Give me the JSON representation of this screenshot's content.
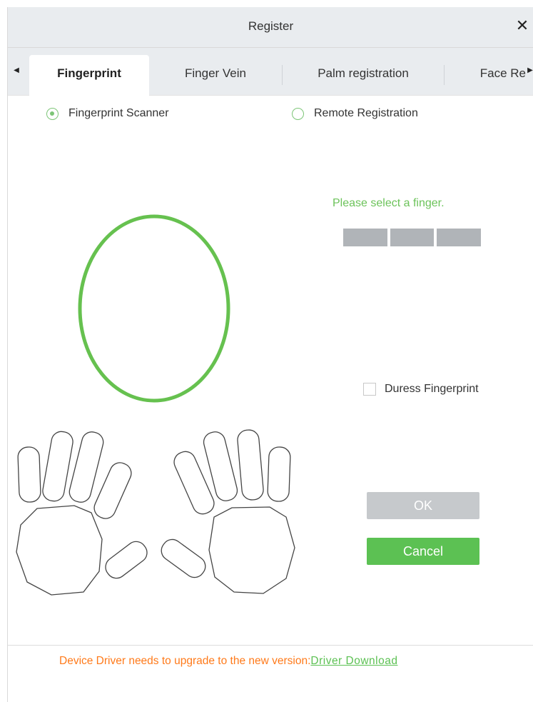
{
  "dialog": {
    "title": "Register",
    "close_glyph": "✕"
  },
  "tabs": {
    "scroll_left_glyph": "◀",
    "scroll_right_glyph": "▶",
    "items": [
      {
        "label": "Fingerprint",
        "active": true
      },
      {
        "label": "Finger Vein",
        "active": false
      },
      {
        "label": "Palm registration",
        "active": false
      },
      {
        "label": "Face Re",
        "active": false
      }
    ]
  },
  "mode": {
    "options": [
      {
        "label": "Fingerprint Scanner",
        "selected": true
      },
      {
        "label": "Remote Registration",
        "selected": false
      }
    ]
  },
  "scan": {
    "hint": "Please select a finger.",
    "progress_segments": 3,
    "progress_filled": 0
  },
  "duress": {
    "label": "Duress Fingerprint",
    "checked": false
  },
  "buttons": {
    "ok": "OK",
    "cancel": "Cancel"
  },
  "footer": {
    "message": "Device Driver needs to upgrade to the new version:",
    "link": "Driver Download"
  },
  "icons": {
    "close": "close-icon",
    "tab_left": "chevron-left-icon",
    "tab_right": "chevron-right-icon"
  },
  "colors": {
    "accent_green": "#5cc153",
    "oval_green": "#66c14f",
    "hint_green": "#6cc35a",
    "warning_orange": "#ff7a1a",
    "disabled_gray": "#c6c9cc"
  }
}
